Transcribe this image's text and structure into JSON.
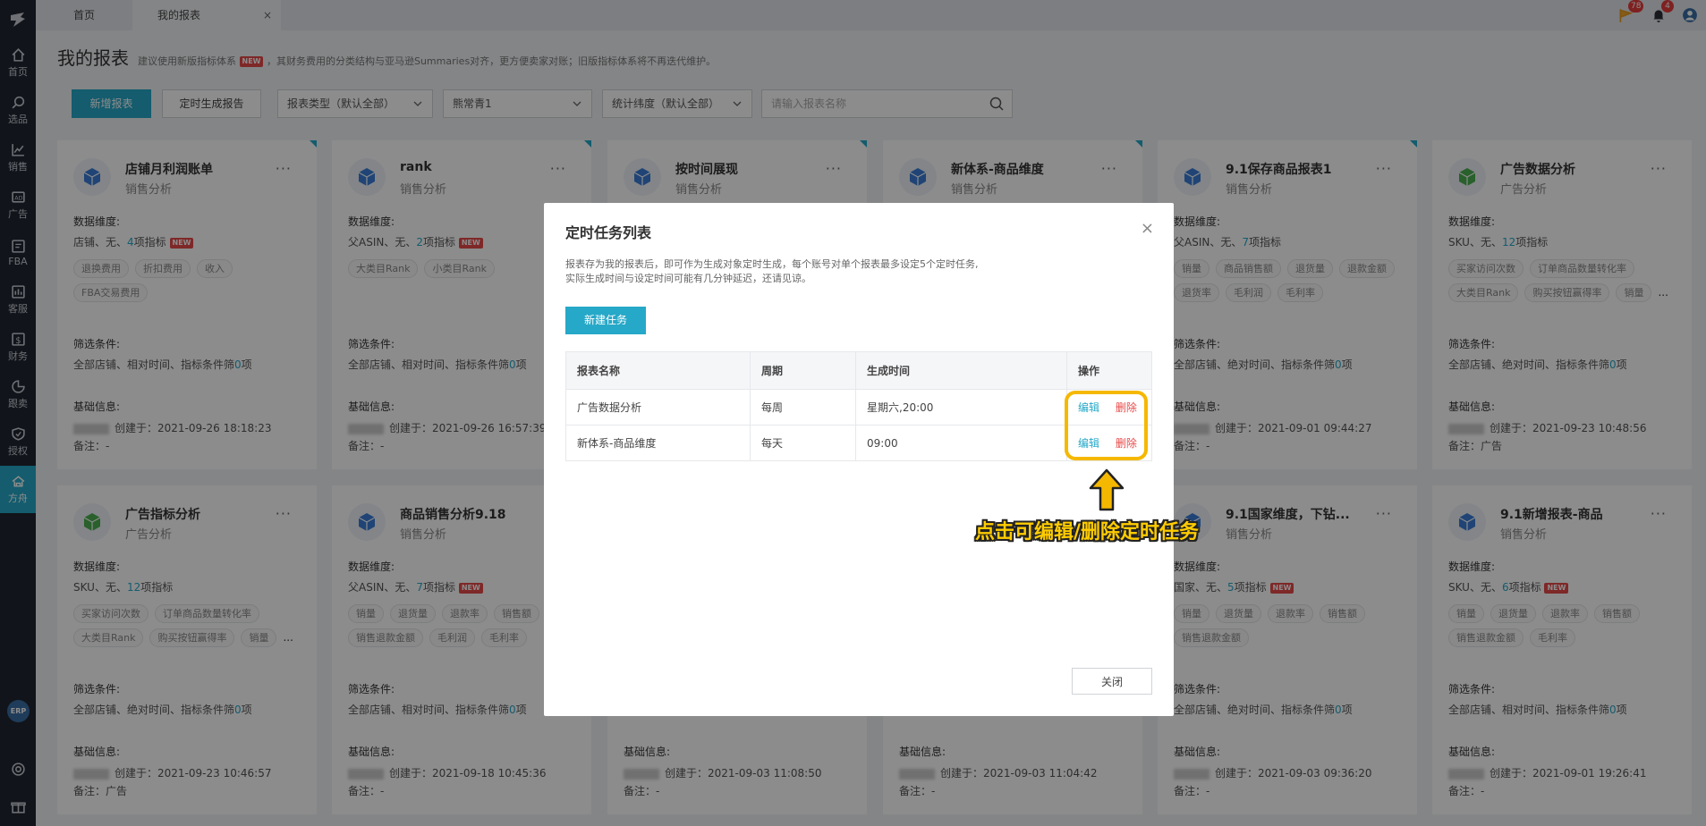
{
  "sidebar": {
    "items": [
      {
        "label": "首页",
        "icon": "home-icon"
      },
      {
        "label": "选品",
        "icon": "search-icon"
      },
      {
        "label": "销售",
        "icon": "chart-line-icon"
      },
      {
        "label": "广告",
        "icon": "ad-icon"
      },
      {
        "label": "FBA",
        "icon": "fba-icon"
      },
      {
        "label": "客服",
        "icon": "service-icon"
      },
      {
        "label": "财务",
        "icon": "dollar-icon"
      },
      {
        "label": "跟卖",
        "icon": "follow-sell-icon"
      },
      {
        "label": "授权",
        "icon": "shield-icon"
      },
      {
        "label": "方舟",
        "icon": "ark-icon"
      }
    ],
    "erp_label": "ERP"
  },
  "tabs": {
    "home": "首页",
    "reports": "我的报表",
    "close": "×"
  },
  "notifications": {
    "flag_count": "78",
    "bell_count": "4"
  },
  "page": {
    "title": "我的报表",
    "tip_prefix": "建议使用新版指标体系",
    "new_badge": "NEW",
    "tip_suffix": "，其财务费用的分类结构与亚马逊Summaries对齐，更方便卖家对账；旧版指标体系将不再迭代维护。"
  },
  "toolbar": {
    "new_report": "新增报表",
    "scheduled": "定时生成报告",
    "report_type": "报表类型（默认全部）",
    "store": "熊常青1",
    "dimension": "统计纬度（默认全部）",
    "search_placeholder": "请输入报表名称"
  },
  "labels": {
    "dimension": "数据维度:",
    "filter": "筛选条件:",
    "basic": "基础信息:",
    "created": "创建于：",
    "note": "备注：",
    "more": "...",
    "menu": "···"
  },
  "cards": [
    {
      "title": "店铺月利润账单",
      "sub": "销售分析",
      "dim_pre": "店铺、无、",
      "dim_num": "4",
      "dim_suf": "项指标",
      "new": true,
      "tags": [
        "退换费用",
        "折扣费用",
        "收入",
        "FBA交易费用"
      ],
      "filter_pre": "全部店铺、相对时间、指标条件筛",
      "filter_num": "0",
      "filter_suf": "项",
      "created": "2021-09-26 18:18:23",
      "note": "-"
    },
    {
      "title": "rank",
      "sub": "销售分析",
      "dim_pre": "父ASIN、无、",
      "dim_num": "2",
      "dim_suf": "项指标",
      "new": true,
      "tags": [
        "大类目Rank",
        "小类目Rank"
      ],
      "filter_pre": "全部店铺、相对时间、指标条件筛",
      "filter_num": "0",
      "filter_suf": "项",
      "created": "2021-09-26 16:57:39",
      "note": "-"
    },
    {
      "title": "按时间展现",
      "sub": "销售分析"
    },
    {
      "title": "新体系-商品维度",
      "sub": "销售分析"
    },
    {
      "title": "9.1保存商品报表1",
      "sub": "销售分析",
      "dim_pre": "父ASIN、无、",
      "dim_num": "7",
      "dim_suf": "项指标",
      "new": false,
      "tags": [
        "销量",
        "商品销售额",
        "退货量",
        "退款金额",
        "退货率",
        "毛利润",
        "毛利率"
      ],
      "filter_pre": "全部店铺、绝对时间、指标条件筛",
      "filter_num": "0",
      "filter_suf": "项",
      "created": "2021-09-01 09:44:27",
      "note": "-"
    },
    {
      "title": "广告数据分析",
      "sub": "广告分析",
      "dim_pre": "SKU、无、",
      "dim_num": "12",
      "dim_suf": "项指标",
      "new": false,
      "tags": [
        "买家访问次数",
        "订单商品数量转化率",
        "大类目Rank",
        "购买按钮赢得率",
        "销量"
      ],
      "filter_pre": "全部店铺、绝对时间、指标条件筛",
      "filter_num": "0",
      "filter_suf": "项",
      "created": "2021-09-23 10:48:56",
      "note": "广告"
    },
    {
      "title": "广告指标分析",
      "sub": "广告分析",
      "dim_pre": "SKU、无、",
      "dim_num": "12",
      "dim_suf": "项指标",
      "new": false,
      "tags": [
        "买家访问次数",
        "订单商品数量转化率",
        "大类目Rank",
        "购买按钮赢得率",
        "销量"
      ],
      "filter_pre": "全部店铺、绝对时间、指标条件筛",
      "filter_num": "0",
      "filter_suf": "项",
      "created": "2021-09-23 10:46:57",
      "note": "广告"
    },
    {
      "title": "商品销售分析9.18",
      "sub": "销售分析",
      "dim_pre": "父ASIN、无、",
      "dim_num": "7",
      "dim_suf": "项指标",
      "new": true,
      "tags": [
        "销量",
        "退货量",
        "退款率",
        "销售额",
        "销售退款金额",
        "毛利润",
        "毛利率"
      ],
      "filter_pre": "全部店铺、相对时间、指标条件筛",
      "filter_num": "0",
      "filter_suf": "项",
      "created": "2021-09-18 10:45:36",
      "note": "-"
    },
    {
      "title": "",
      "sub": "",
      "created": "2021-09-03 11:08:50",
      "note": "-"
    },
    {
      "title": "",
      "sub": "",
      "created": "2021-09-03 11:04:42",
      "note": "-"
    },
    {
      "title": "9.1国家维度，下钻...",
      "sub": "销售分析",
      "dim_pre": "国家、无、",
      "dim_num": "5",
      "dim_suf": "项指标",
      "new": true,
      "tags": [
        "销量",
        "退货量",
        "退款率",
        "销售额",
        "销售退款金额"
      ],
      "filter_pre": "全部店铺、绝对时间、指标条件筛",
      "filter_num": "0",
      "filter_suf": "项",
      "created": "2021-09-03 09:36:20",
      "note": "-"
    },
    {
      "title": "9.1新增报表-商品",
      "sub": "销售分析",
      "dim_pre": "SKU、无、",
      "dim_num": "6",
      "dim_suf": "项指标",
      "new": true,
      "tags": [
        "销量",
        "退货量",
        "退款率",
        "销售额",
        "销售退款金额",
        "毛利率"
      ],
      "filter_pre": "全部店铺、相对时间、指标条件筛",
      "filter_num": "0",
      "filter_suf": "项",
      "created": "2021-09-01 19:26:41",
      "note": "-"
    }
  ],
  "modal": {
    "title": "定时任务列表",
    "close_x": "×",
    "desc_line1": "报表存为我的报表后，即可作为生成对象定时生成，每个账号对单个报表最多设定5个定时任务,",
    "desc_line2": "实际生成时间与设定时间可能有几分钟延迟，还请见谅。",
    "new_task": "新建任务",
    "columns": [
      "报表名称",
      "周期",
      "生成时间",
      "操作"
    ],
    "rows": [
      {
        "name": "广告数据分析",
        "cycle": "每周",
        "time": "星期六,20:00",
        "edit": "编辑",
        "delete": "删除"
      },
      {
        "name": "新体系-商品维度",
        "cycle": "每天",
        "time": "09:00",
        "edit": "编辑",
        "delete": "删除"
      }
    ],
    "close_btn": "关闭"
  },
  "annotation": {
    "text": "点击可编辑/删除定时任务",
    "color": "#f5b800"
  },
  "colors": {
    "accent": "#26a8c8",
    "sidebar_bg": "#1f2530",
    "danger": "#e84a4a"
  }
}
